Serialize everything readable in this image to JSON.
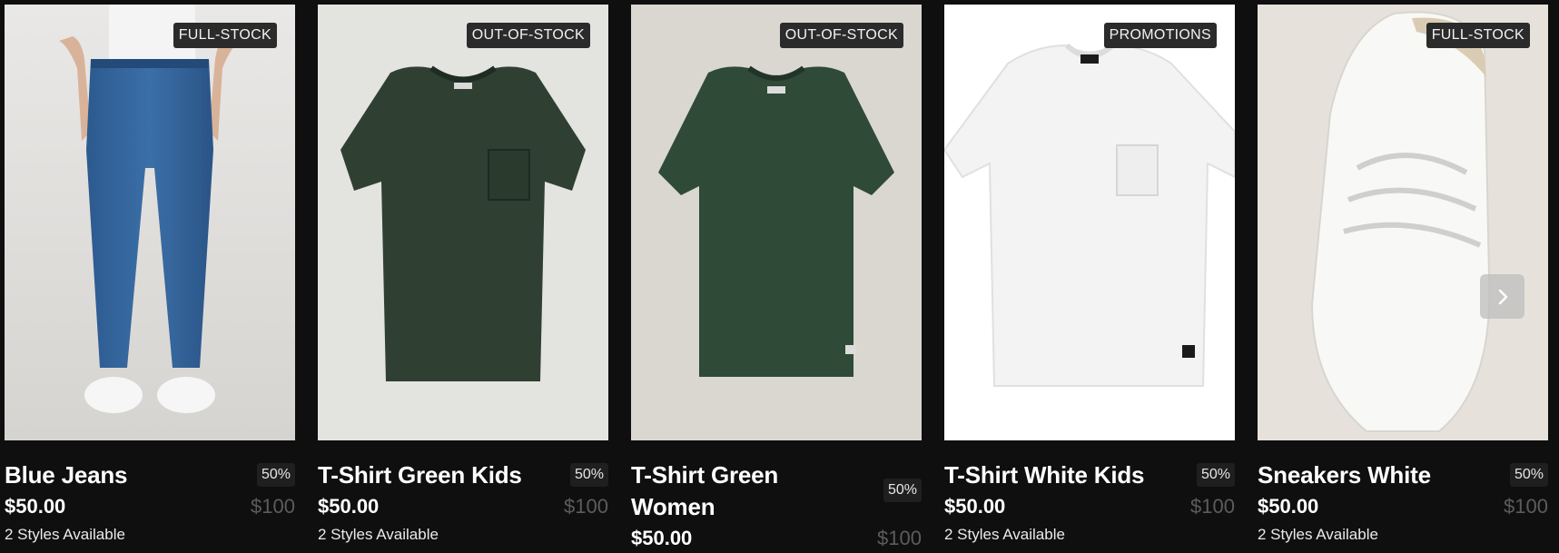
{
  "products": [
    {
      "badge": "FULL-STOCK",
      "name": "Blue Jeans",
      "discount": "50%",
      "price": "$50.00",
      "old_price": "$100",
      "styles": "2 Styles Available",
      "image_icon": "blue-jeans-image"
    },
    {
      "badge": "OUT-OF-STOCK",
      "name": "T-Shirt Green Kids",
      "discount": "50%",
      "price": "$50.00",
      "old_price": "$100",
      "styles": "2 Styles Available",
      "image_icon": "green-tshirt-image"
    },
    {
      "badge": "OUT-OF-STOCK",
      "name": "T-Shirt Green Women",
      "discount": "50%",
      "price": "$50.00",
      "old_price": "$100",
      "styles": "",
      "image_icon": "green-tshirt-image"
    },
    {
      "badge": "PROMOTIONS",
      "name": "T-Shirt White Kids",
      "discount": "50%",
      "price": "$50.00",
      "old_price": "$100",
      "styles": "2 Styles Available",
      "image_icon": "white-tshirt-image"
    },
    {
      "badge": "FULL-STOCK",
      "name": "Sneakers White",
      "discount": "50%",
      "price": "$50.00",
      "old_price": "$100",
      "styles": "2 Styles Available",
      "image_icon": "white-sneaker-image"
    }
  ],
  "carousel": {
    "next_icon": "chevron-right-icon"
  },
  "colors": {
    "background": "#0f0f0f",
    "badge_bg": "#2b2b2b",
    "old_price": "#5c5c5c"
  }
}
